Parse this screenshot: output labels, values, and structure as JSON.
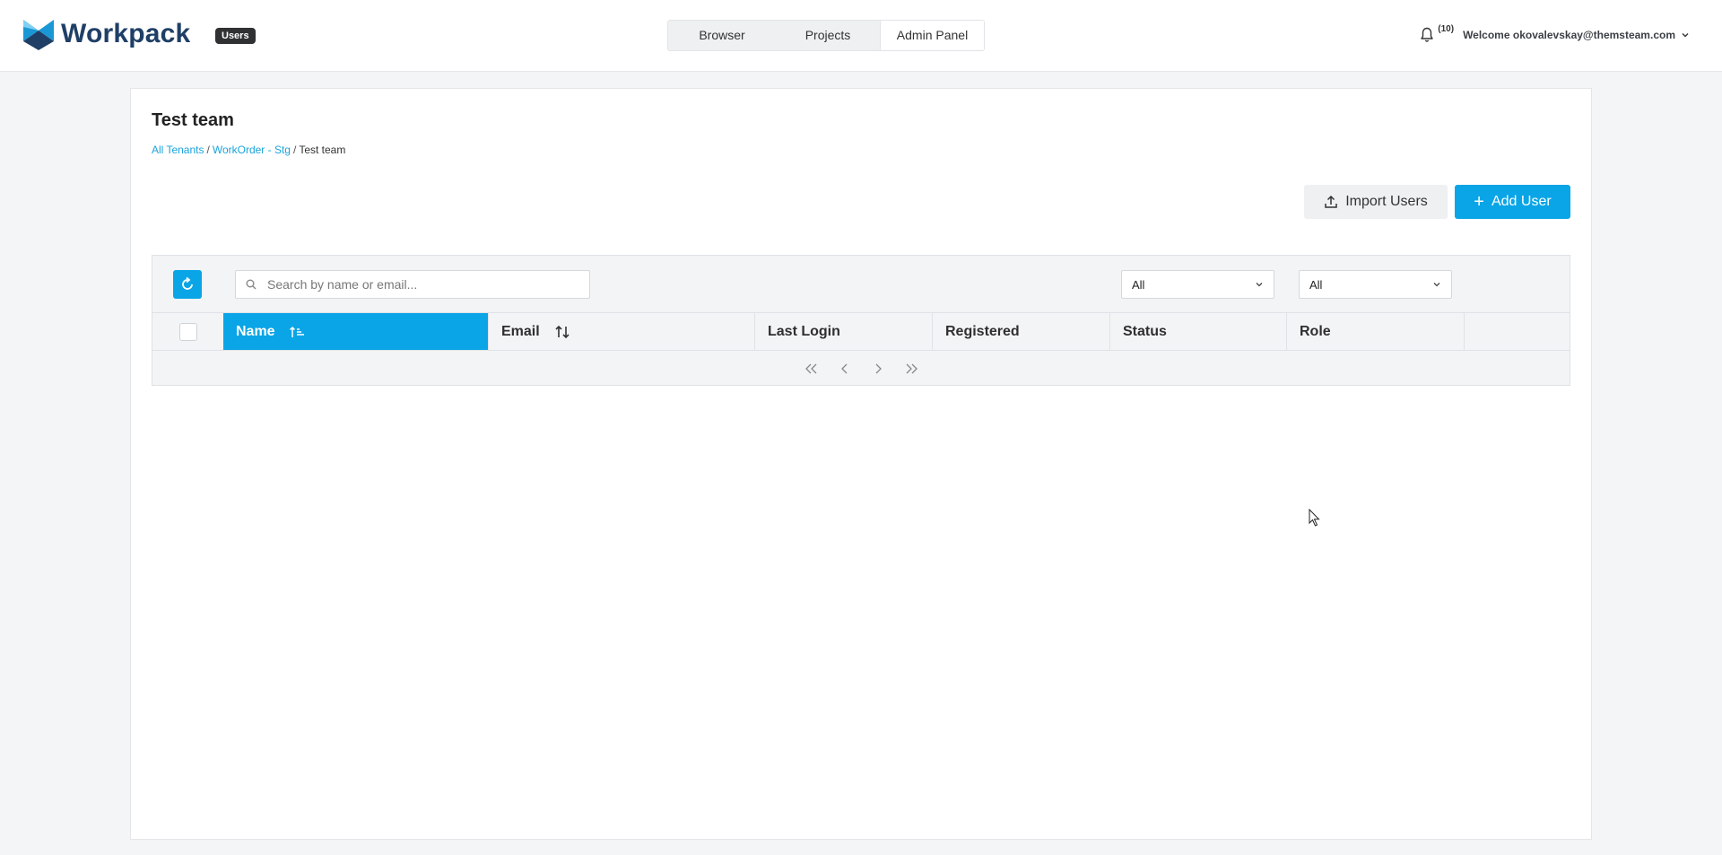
{
  "header": {
    "brand": "Workpack",
    "badge": "Users",
    "nav": [
      {
        "label": "Browser"
      },
      {
        "label": "Projects"
      },
      {
        "label": "Admin Panel"
      }
    ],
    "notification_count": "(10)",
    "welcome": "Welcome okovalevskay@themsteam.com"
  },
  "page": {
    "title": "Test team",
    "breadcrumb": [
      "All Tenants",
      "WorkOrder - Stg",
      "Test team"
    ],
    "import_label": "Import Users",
    "add_label": "Add User"
  },
  "table": {
    "search_placeholder": "Search by name or email...",
    "filter1": "All",
    "filter2": "All",
    "columns": [
      "Name",
      "Email",
      "Last Login",
      "Registered",
      "Status",
      "Role"
    ]
  },
  "colors": {
    "accent": "#0aa5e6",
    "brand": "#1f3f66"
  }
}
